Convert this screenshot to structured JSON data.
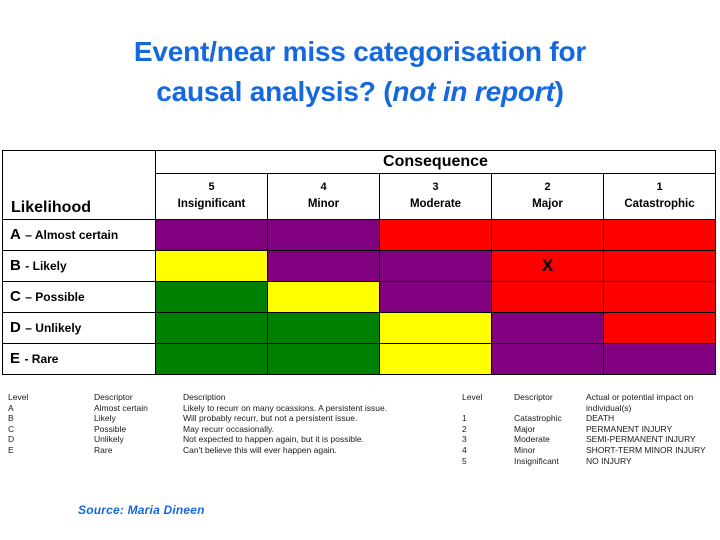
{
  "slide": {
    "title_line1": "Event/near miss categorisation for",
    "title_line2_plain": "causal analysis? (",
    "title_line2_italic": "not in report",
    "title_line2_tail": ")",
    "title_color": "#1668dd",
    "source": "Source: Maria Dineen"
  },
  "matrix": {
    "likelihood_header": "Likelihood",
    "consequence_header": "Consequence",
    "consequence_columns": [
      {
        "number": "5",
        "name": "Insignificant"
      },
      {
        "number": "4",
        "name": "Minor"
      },
      {
        "number": "3",
        "name": "Moderate"
      },
      {
        "number": "2",
        "name": "Major"
      },
      {
        "number": "1",
        "name": "Catastrophic"
      }
    ],
    "rows": [
      {
        "letter": "A",
        "label": "– Almost certain",
        "cells": [
          {
            "color": "#800080",
            "mark": ""
          },
          {
            "color": "#800080",
            "mark": ""
          },
          {
            "color": "#ff0000",
            "mark": ""
          },
          {
            "color": "#ff0000",
            "mark": ""
          },
          {
            "color": "#ff0000",
            "mark": ""
          }
        ]
      },
      {
        "letter": "B",
        "label": "- Likely",
        "cells": [
          {
            "color": "#ffff00",
            "mark": ""
          },
          {
            "color": "#800080",
            "mark": ""
          },
          {
            "color": "#800080",
            "mark": ""
          },
          {
            "color": "#ff0000",
            "mark": "X"
          },
          {
            "color": "#ff0000",
            "mark": ""
          }
        ]
      },
      {
        "letter": "C",
        "label": "– Possible",
        "cells": [
          {
            "color": "#008000",
            "mark": ""
          },
          {
            "color": "#ffff00",
            "mark": ""
          },
          {
            "color": "#800080",
            "mark": ""
          },
          {
            "color": "#ff0000",
            "mark": ""
          },
          {
            "color": "#ff0000",
            "mark": ""
          }
        ]
      },
      {
        "letter": "D",
        "label": "– Unlikely",
        "cells": [
          {
            "color": "#008000",
            "mark": ""
          },
          {
            "color": "#008000",
            "mark": ""
          },
          {
            "color": "#ffff00",
            "mark": ""
          },
          {
            "color": "#800080",
            "mark": ""
          },
          {
            "color": "#ff0000",
            "mark": ""
          }
        ]
      },
      {
        "letter": "E",
        "label": "- Rare",
        "cells": [
          {
            "color": "#008000",
            "mark": ""
          },
          {
            "color": "#008000",
            "mark": ""
          },
          {
            "color": "#ffff00",
            "mark": ""
          },
          {
            "color": "#800080",
            "mark": ""
          },
          {
            "color": "#800080",
            "mark": ""
          }
        ]
      }
    ],
    "colors": {
      "green": "#008000",
      "yellow": "#ffff00",
      "purple": "#800080",
      "red": "#ff0000"
    }
  },
  "legend_likelihood": {
    "headers": [
      "Level",
      "Descriptor",
      "Description"
    ],
    "rows": [
      [
        "A",
        "Almost certain",
        "Likely to recurr on many ocassions. A persistent issue."
      ],
      [
        "B",
        "Likely",
        "Will probably recurr, but not a persistent issue."
      ],
      [
        "C",
        "Possible",
        "May recurr occasionally."
      ],
      [
        "D",
        "Unlikely",
        "Not expected to happen again, but it is possible."
      ],
      [
        "E",
        "Rare",
        "Can't believe this will ever happen again."
      ]
    ]
  },
  "legend_consequence": {
    "headers": [
      "Level",
      "Descriptor",
      "Actual or potential impact on individual(s)"
    ],
    "rows": [
      [
        "1",
        "Catastrophic",
        "DEATH"
      ],
      [
        "2",
        "Major",
        "PERMANENT INJURY"
      ],
      [
        "3",
        "Moderate",
        "SEMI-PERMANENT INJURY"
      ],
      [
        "4",
        "Minor",
        "SHORT-TERM MINOR INJURY"
      ],
      [
        "5",
        "Insignificant",
        "NO INJURY"
      ]
    ]
  }
}
